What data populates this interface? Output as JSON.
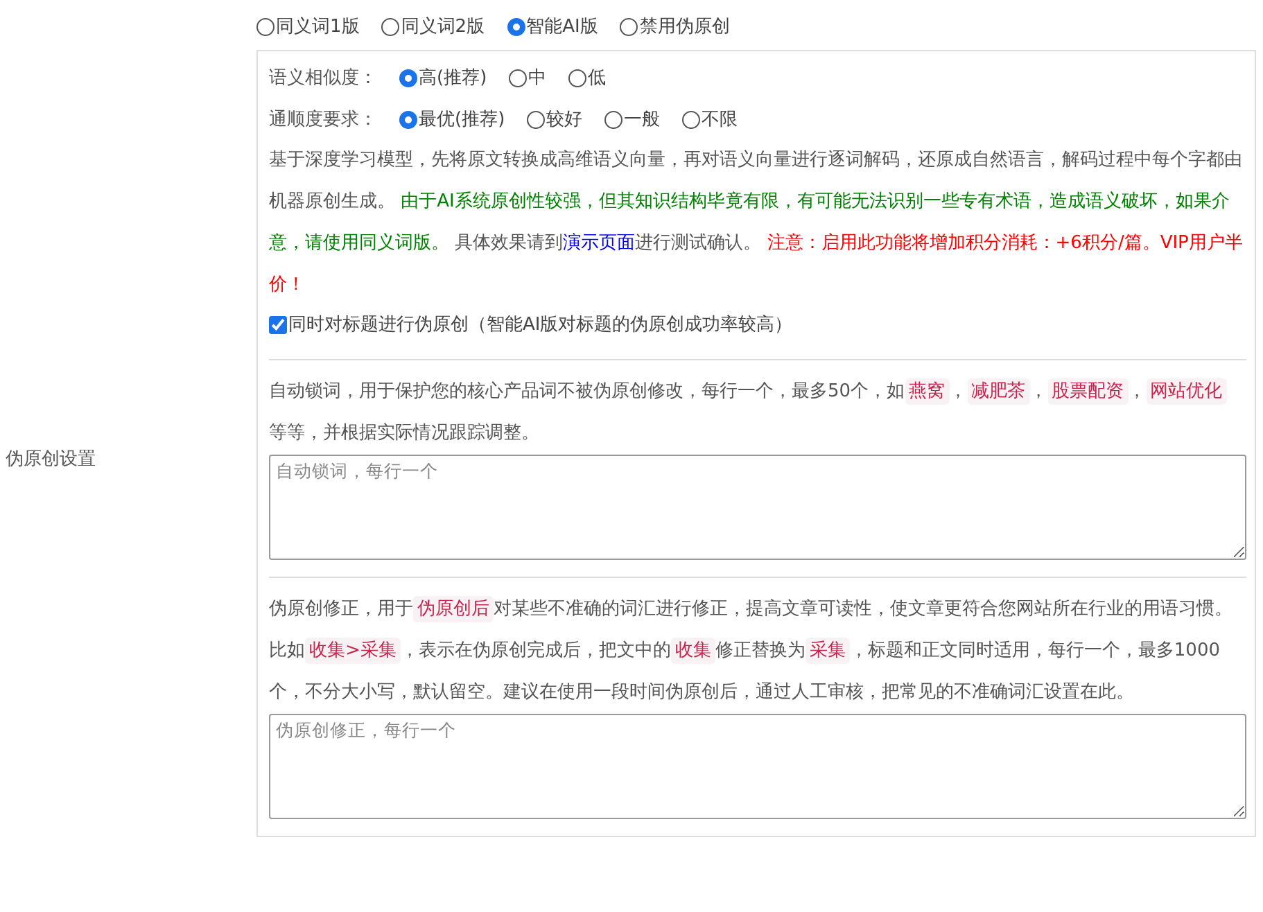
{
  "side_label": "伪原创设置",
  "versions": [
    {
      "label": "同义词1版",
      "selected": false
    },
    {
      "label": "同义词2版",
      "selected": false
    },
    {
      "label": "智能AI版",
      "selected": true
    },
    {
      "label": "禁用伪原创",
      "selected": false
    }
  ],
  "similarity": {
    "label": "语义相似度：",
    "options": [
      {
        "label": "高(推荐)",
        "selected": true
      },
      {
        "label": "中",
        "selected": false
      },
      {
        "label": "低",
        "selected": false
      }
    ]
  },
  "fluency": {
    "label": "通顺度要求：",
    "options": [
      {
        "label": "最优(推荐)",
        "selected": true
      },
      {
        "label": "较好",
        "selected": false
      },
      {
        "label": "一般",
        "selected": false
      },
      {
        "label": "不限",
        "selected": false
      }
    ]
  },
  "description": [
    {
      "kind": "plain",
      "text": "基于深度学习模型，先将原文转换成高维语义向量，再对语义向量进行逐词解码，还原成自然语言，解码过程中每个字都由机器原创生成。 "
    },
    {
      "kind": "green",
      "text": "由于AI系统原创性较强，但其知识结构毕竟有限，有可能无法识别一些专有术语，造成语义破坏，如果介意，请使用同义词版。"
    },
    {
      "kind": "plain",
      "text": " 具体效果请到"
    },
    {
      "kind": "link",
      "text": "演示页面"
    },
    {
      "kind": "plain",
      "text": "进行测试确认。 "
    },
    {
      "kind": "red",
      "text": "注意：启用此功能将增加积分消耗：+6积分/篇。VIP用户半价！"
    }
  ],
  "title_option": {
    "label": "同时对标题进行伪原创（智能AI版对标题的伪原创成功率较高）",
    "checked": true
  },
  "lock_words": {
    "text": [
      {
        "kind": "plain",
        "text": "自动锁词，用于保护您的核心产品词不被伪原创修改，每行一个，最多50个，如"
      },
      {
        "kind": "code",
        "text": "燕窝"
      },
      {
        "kind": "plain",
        "text": "，"
      },
      {
        "kind": "code",
        "text": "减肥茶"
      },
      {
        "kind": "plain",
        "text": "，"
      },
      {
        "kind": "code",
        "text": "股票配资"
      },
      {
        "kind": "plain",
        "text": "，"
      },
      {
        "kind": "code",
        "text": "网站优化"
      },
      {
        "kind": "plain",
        "text": " 等等，并根据实际情况跟踪调整。"
      }
    ],
    "placeholder": "自动锁词，每行一个"
  },
  "correction": {
    "text": [
      {
        "kind": "plain",
        "text": "伪原创修正，用于"
      },
      {
        "kind": "code",
        "text": "伪原创后"
      },
      {
        "kind": "plain",
        "text": "对某些不准确的词汇进行修正，提高文章可读性，使文章更符合您网站所在行业的用语习惯。比如"
      },
      {
        "kind": "code",
        "text": "收集>采集"
      },
      {
        "kind": "plain",
        "text": "，表示在伪原创完成后，把文中的"
      },
      {
        "kind": "code",
        "text": "收集"
      },
      {
        "kind": "plain",
        "text": "修正替换为"
      },
      {
        "kind": "code",
        "text": "采集"
      },
      {
        "kind": "plain",
        "text": "，标题和正文同时适用，每行一个，最多1000个，不分大小写，默认留空。建议在使用一段时间伪原创后，通过人工审核，把常见的不准确词汇设置在此。"
      }
    ],
    "placeholder": "伪原创修正，每行一个"
  }
}
